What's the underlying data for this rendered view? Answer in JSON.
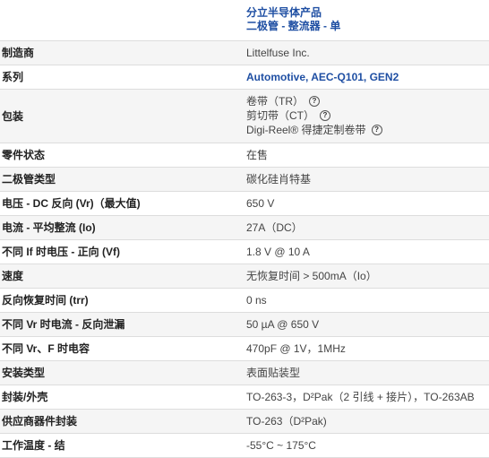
{
  "category": {
    "line1": "分立半导体产品",
    "line2": "二极管 - 整流器 - 单"
  },
  "rows": [
    {
      "label": "制造商",
      "value": "Littelfuse Inc."
    },
    {
      "label": "系列",
      "value": "Automotive, AEC-Q101, GEN2"
    },
    {
      "label": "包装",
      "options": [
        "卷带（TR）",
        "剪切带（CT）",
        "Digi-Reel® 得捷定制卷带"
      ],
      "help_icon": "question-circle-icon"
    },
    {
      "label": "零件状态",
      "value": "在售"
    },
    {
      "label": "二极管类型",
      "value": "碳化硅肖特基"
    },
    {
      "label": "电压 - DC 反向 (Vr)（最大值)",
      "value": "650 V"
    },
    {
      "label": "电流 - 平均整流 (Io)",
      "value": "27A（DC）"
    },
    {
      "label": "不同 If 时电压 - 正向 (Vf)",
      "value": "1.8 V @ 10 A"
    },
    {
      "label": "速度",
      "value": "无恢复时间 > 500mA（Io）"
    },
    {
      "label": "反向恢复时间 (trr)",
      "value": "0 ns"
    },
    {
      "label": "不同 Vr 时电流 - 反向泄漏",
      "value": "50 µA @ 650 V"
    },
    {
      "label": "不同 Vr、F 时电容",
      "value": "470pF @ 1V，1MHz"
    },
    {
      "label": "安装类型",
      "value": "表面贴装型"
    },
    {
      "label": "封装/外壳",
      "value": "TO-263-3，D²Pak（2 引线 + 接片），TO-263AB"
    },
    {
      "label": "供应商器件封装",
      "value": "TO-263（D²Pak)"
    },
    {
      "label": "工作温度 - 结",
      "value": "-55°C ~ 175°C"
    }
  ],
  "colors": {
    "link": "#1f4fa3",
    "stripe": "#f5f5f5",
    "border": "#dddddd"
  }
}
